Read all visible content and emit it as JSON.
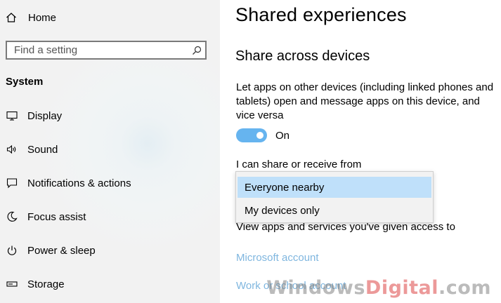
{
  "sidebar": {
    "home_label": "Home",
    "search_placeholder": "Find a setting",
    "section_title": "System",
    "items": [
      {
        "label": "Display",
        "icon": "monitor-icon"
      },
      {
        "label": "Sound",
        "icon": "speaker-icon"
      },
      {
        "label": "Notifications & actions",
        "icon": "notification-icon"
      },
      {
        "label": "Focus assist",
        "icon": "moon-icon"
      },
      {
        "label": "Power & sleep",
        "icon": "power-icon"
      },
      {
        "label": "Storage",
        "icon": "storage-icon"
      }
    ]
  },
  "main": {
    "title": "Shared experiences",
    "section_title": "Share across devices",
    "description": "Let apps on other devices (including linked phones and tablets) open and message apps on this device, and vice versa",
    "toggle": {
      "state": "on",
      "label": "On"
    },
    "share_label": "I can share or receive from",
    "dropdown_options": [
      "Everyone nearby",
      "My devices only"
    ],
    "dropdown_selected": "Everyone nearby",
    "partial_text": "View apps and services you've given access to",
    "links": [
      "Microsoft account",
      "Work or school account"
    ]
  },
  "watermark": {
    "part1": "Windows",
    "part2": "Digital",
    "part3": ".com"
  },
  "colors": {
    "accent": "#66b4ef",
    "link": "#7fb6df",
    "selected": "#bfe0fa",
    "sidebar_bg": "#f2f2f2"
  }
}
